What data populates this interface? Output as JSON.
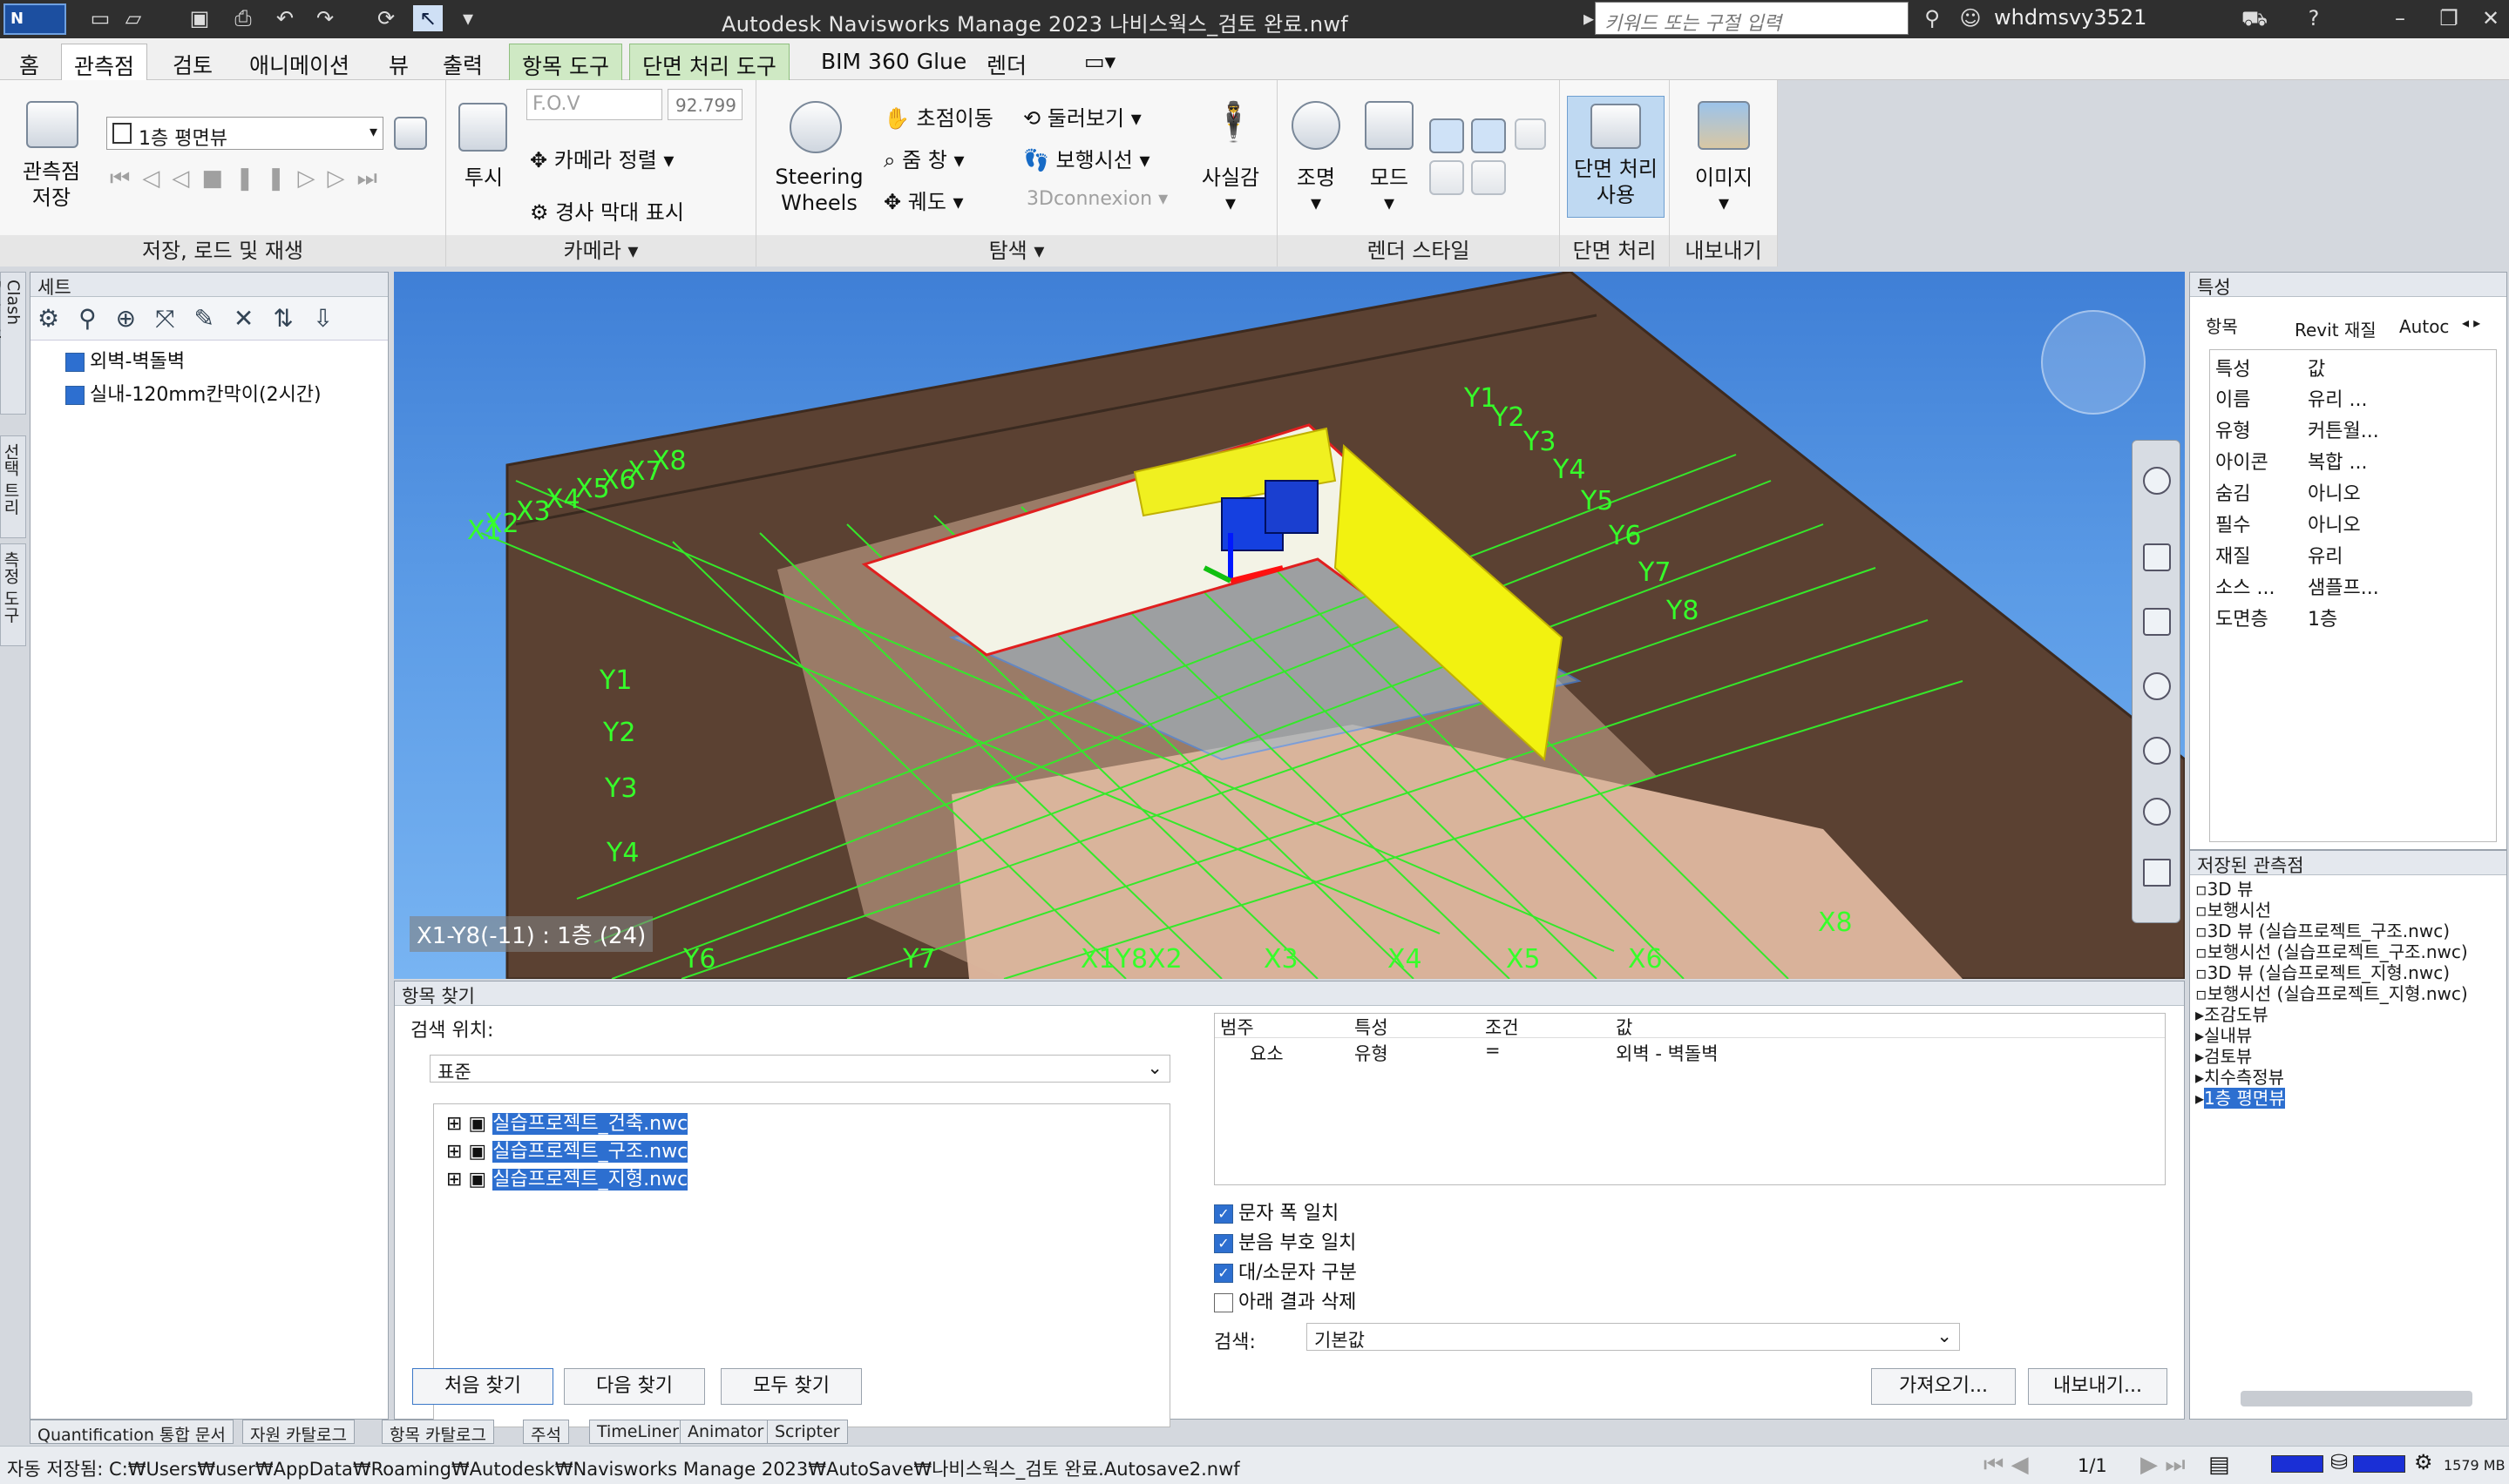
{
  "titlebar": {
    "logo": "N MAN",
    "title": "Autodesk Navisworks Manage 2023    나비스웍스_검토 완료.nwf",
    "search_placeholder": "키워드 또는 구절 입력",
    "user": "whdmsvy3521",
    "icons": [
      "new-file-icon",
      "open-icon",
      "save-icon",
      "print-icon",
      "undo-icon",
      "redo-icon",
      "refresh-icon",
      "select-icon",
      "binoculars-icon",
      "cart-icon",
      "help-icon",
      "minimize-icon",
      "restore-icon",
      "close-icon"
    ]
  },
  "tabs": [
    "홈",
    "관측점",
    "검토",
    "애니메이션",
    "뷰",
    "출력",
    "항목 도구",
    "단면 처리 도구",
    "BIM 360 Glue",
    "렌더"
  ],
  "active_tab": "관측점",
  "ribbon": {
    "save_load": {
      "title": "저장, 로드 및 재생",
      "save_viewpoint": "관측점\n저장",
      "viewpoint_dropdown": "1층 평면뷰"
    },
    "camera": {
      "title": "카메라",
      "perspective": "투시",
      "fov_label": "F.O.V",
      "fov_value": "92.799",
      "align_camera": "카메라 정렬",
      "show_tilt": "경사 막대 표시"
    },
    "navigate": {
      "title": "탐색",
      "steering": "Steering\nWheels",
      "pan": "초점이동",
      "orbit": "둘러보기",
      "zoom": "줌 창",
      "walk": "보행시선",
      "orbit2": "궤도",
      "connexion": "3Dconnexion",
      "realism": "사실감"
    },
    "render_style": {
      "title": "렌더 스타일",
      "lighting": "조명",
      "mode": "모드"
    },
    "sectioning": {
      "title": "단면 처리",
      "enable": "단면 처리\n사용"
    },
    "export": {
      "title": "내보내기",
      "image": "이미지"
    }
  },
  "sets_panel": {
    "title": "세트",
    "items": [
      "외벽-벽돌벽",
      "실내-120mm칸막이(2시간)"
    ]
  },
  "side_tabs": [
    "Clash Detective",
    "선택 트리",
    "측정 도구"
  ],
  "viewport": {
    "grid_labels_x": [
      "X1",
      "X2",
      "X3",
      "X4",
      "X5",
      "X6",
      "X7",
      "X8"
    ],
    "grid_labels_y": [
      "Y1",
      "Y2",
      "Y3",
      "Y4",
      "Y5",
      "Y6",
      "Y7",
      "Y8"
    ],
    "overlay": "X1-Y8(-11) : 1층 (24)",
    "bottom_labels": [
      "Y6",
      "Y7",
      "X1Y8X2",
      "X3",
      "X4",
      "X5",
      "X6",
      "X8",
      "Y7"
    ]
  },
  "find_items": {
    "title": "항목 찾기",
    "search_in_label": "검색 위치:",
    "search_in_value": "표준",
    "files": [
      "실습프로젝트_건축.nwc",
      "실습프로젝트_구조.nwc",
      "실습프로젝트_지형.nwc"
    ],
    "grid_headers": [
      "범주",
      "특성",
      "조건",
      "값"
    ],
    "grid_row": [
      "요소",
      "유형",
      "=",
      "외벽 - 벽돌벽"
    ],
    "options": [
      {
        "label": "문자 폭 일치",
        "checked": true
      },
      {
        "label": "분음 부호 일치",
        "checked": true
      },
      {
        "label": "대/소문자 구분",
        "checked": true
      },
      {
        "label": "아래 결과 삭제",
        "checked": false
      }
    ],
    "search_label": "검색:",
    "search_value": "기본값",
    "buttons": {
      "first": "처음 찾기",
      "next": "다음 찾기",
      "all": "모두 찾기",
      "import": "가져오기...",
      "export": "내보내기..."
    }
  },
  "properties": {
    "title": "특성",
    "tabs": [
      "항목",
      "Revit 재질",
      "Autoc"
    ],
    "headers": [
      "특성",
      "값"
    ],
    "rows": [
      [
        "이름",
        "유리 ..."
      ],
      [
        "유형",
        "커튼월..."
      ],
      [
        "아이콘",
        "복합 ..."
      ],
      [
        "숨김",
        "아니오"
      ],
      [
        "필수",
        "아니오"
      ],
      [
        "재질",
        "유리"
      ],
      [
        "소스 ...",
        "샘플프..."
      ],
      [
        "도면층",
        "1층"
      ]
    ]
  },
  "saved_viewpoints": {
    "title": "저장된 관측점",
    "items": [
      "3D 뷰",
      "보행시선",
      "3D 뷰 (실습프로젝트_구조.nwc)",
      "보행시선 (실습프로젝트_구조.nwc)",
      "3D 뷰 (실습프로젝트_지형.nwc)",
      "보행시선 (실습프로젝트_지형.nwc)",
      "조감도뷰",
      "실내뷰",
      "검토뷰",
      "치수측정뷰",
      "1층 평면뷰"
    ],
    "selected": "1층 평면뷰"
  },
  "bottom_tabs": [
    "Quantification 통합 문서",
    "자원 카탈로그",
    "항목 카탈로그",
    "주석",
    "TimeLiner",
    "Animator",
    "Scripter"
  ],
  "status": {
    "autosave": "자동 저장됨: C:₩Users₩user₩AppData₩Roaming₩Autodesk₩Navisworks Manage 2023₩AutoSave₩나비스웍스_검토 완료.Autosave2.nwf",
    "page": "1/1",
    "memory": "1579 MB"
  },
  "colors": {
    "accent": "#2d6fd0",
    "grid": "#36ff2a",
    "ground": "#5a3f2e",
    "sky": "#4d8fe0"
  }
}
